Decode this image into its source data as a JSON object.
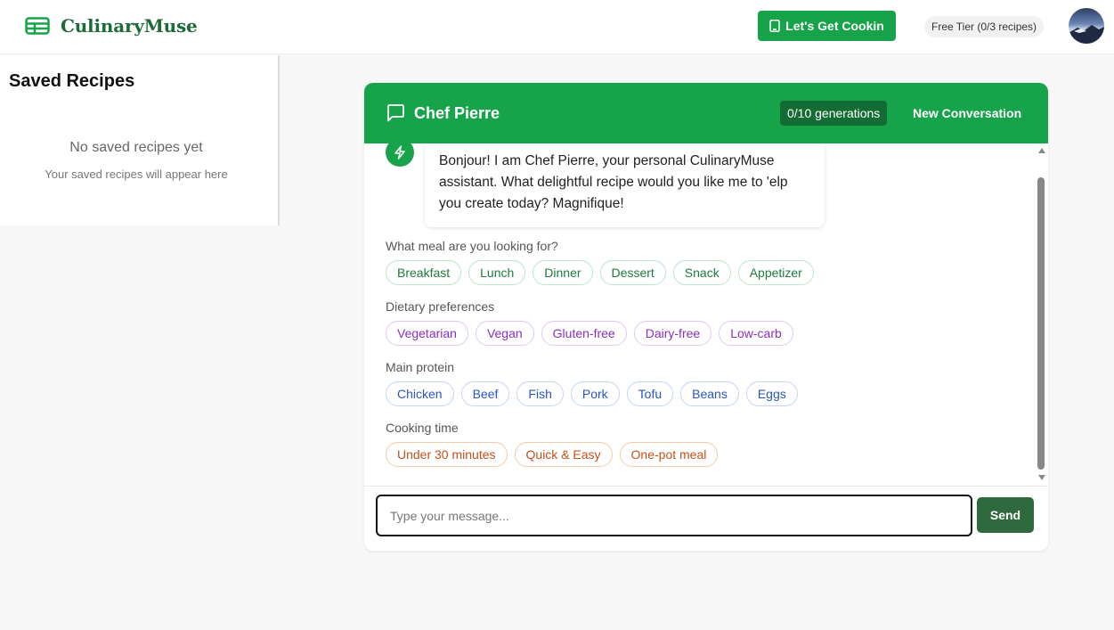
{
  "header": {
    "brand_name": "CulinaryMuse",
    "cook_button_label": "Let's Get Cookin",
    "tier_badge": "Free Tier (0/3 recipes)",
    "brand_color": "#16a34a"
  },
  "sidebar": {
    "title": "Saved Recipes",
    "empty_title": "No saved recipes yet",
    "empty_subtitle": "Your saved recipes will appear here"
  },
  "chat": {
    "title": "Chef Pierre",
    "generations_badge": "0/10 generations",
    "new_conversation_label": "New Conversation",
    "bot_message": "Bonjour! I am Chef Pierre, your personal CulinaryMuse assistant. What delightful recipe would you like me to 'elp you create today? Magnifique!",
    "groups": [
      {
        "label": "What meal are you looking for?",
        "options": [
          "Breakfast",
          "Lunch",
          "Dinner",
          "Dessert",
          "Snack",
          "Appetizer"
        ]
      },
      {
        "label": "Dietary preferences",
        "options": [
          "Vegetarian",
          "Vegan",
          "Gluten-free",
          "Dairy-free",
          "Low-carb"
        ]
      },
      {
        "label": "Main protein",
        "options": [
          "Chicken",
          "Beef",
          "Fish",
          "Pork",
          "Tofu",
          "Beans",
          "Eggs"
        ]
      },
      {
        "label": "Cooking time",
        "options": [
          "Under 30 minutes",
          "Quick & Easy",
          "One-pot meal"
        ]
      }
    ],
    "input": {
      "placeholder": "Type your message...",
      "value": ""
    },
    "send_label": "Send"
  }
}
